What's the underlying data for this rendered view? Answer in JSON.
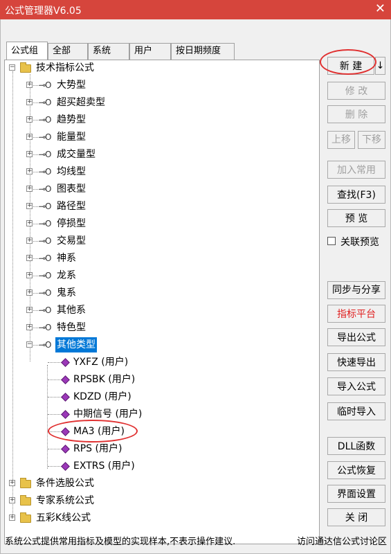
{
  "window": {
    "title": "公式管理器V6.05"
  },
  "tabs": [
    {
      "label": "公式组"
    },
    {
      "label": "全部"
    },
    {
      "label": "系统"
    },
    {
      "label": "用户"
    },
    {
      "label": "按日期频度"
    }
  ],
  "tree": {
    "root": "技术指标公式",
    "categories": [
      "大势型",
      "超买超卖型",
      "趋势型",
      "能量型",
      "成交量型",
      "均线型",
      "图表型",
      "路径型",
      "停损型",
      "交易型",
      "神系",
      "龙系",
      "鬼系",
      "其他系",
      "特色型",
      "其他类型"
    ],
    "formulas": [
      "YXFZ  (用户)",
      "RPSBK  (用户)",
      "KDZD  (用户)",
      "中期信号  (用户)",
      "MA3  (用户)",
      "RPS  (用户)",
      "EXTRS  (用户)"
    ],
    "other_roots": [
      "条件选股公式",
      "专家系统公式",
      "五彩K线公式"
    ]
  },
  "buttons": {
    "new": "新 建",
    "new_dropdown": "↓",
    "modify": "修 改",
    "delete": "删 除",
    "move_up": "上移",
    "move_down": "下移",
    "add_common": "加入常用",
    "find": "查找(F3)",
    "preview": "预 览",
    "linked_preview": "关联预览",
    "sync_share": "同步与分享",
    "indicator_platform": "指标平台",
    "export": "导出公式",
    "quick_export": "快速导出",
    "import": "导入公式",
    "temp_import": "临时导入",
    "dll": "DLL函数",
    "restore": "公式恢复",
    "ui_settings": "界面设置",
    "close": "关 闭"
  },
  "status": {
    "left": "系统公式提供常用指标及模型的实现样本,不表示操作建议.",
    "right": "访问通达信公式讨论区"
  },
  "colors": {
    "titlebar": "#d6453c",
    "selection": "#0078d7",
    "highlight_red": "#e02020"
  }
}
